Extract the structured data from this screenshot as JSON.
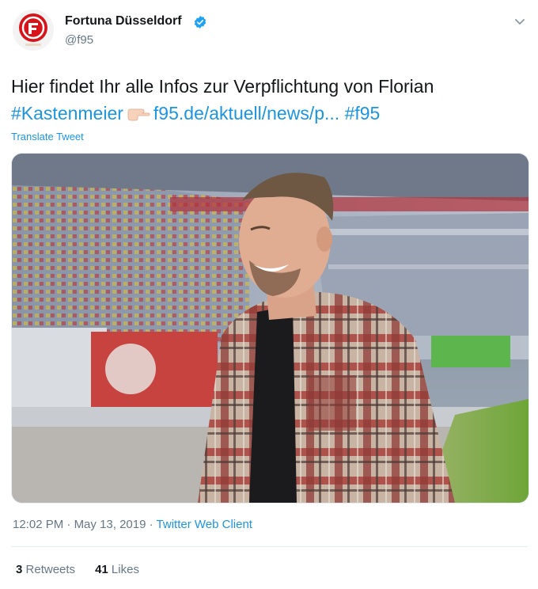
{
  "header": {
    "display_name": "Fortuna Düsseldorf",
    "handle": "@f95",
    "verified_icon": "verified-badge-icon",
    "menu_icon": "chevron-down-icon"
  },
  "tweet": {
    "text_line1": "Hier findet Ihr alle Infos zur Verpflichtung von Florian",
    "hashtag1": "#Kastenmeier",
    "emoji": "pointing-right-hand-icon",
    "link": "f95.de/aktuell/news/p...",
    "hashtag2": "#f95",
    "translate_label": "Translate Tweet"
  },
  "media": {
    "type": "photo"
  },
  "meta": {
    "time": "12:02 PM",
    "sep1": "·",
    "date": "May 13, 2019",
    "sep2": "·",
    "source": "Twitter Web Client"
  },
  "stats": {
    "retweets_count": "3",
    "retweets_label": "Retweets",
    "likes_count": "41",
    "likes_label": "Likes"
  },
  "colors": {
    "link": "#1b95e0",
    "text": "#14171a",
    "secondary": "#657786",
    "brand_red": "#d7141a",
    "divider": "#e6ecf0"
  }
}
